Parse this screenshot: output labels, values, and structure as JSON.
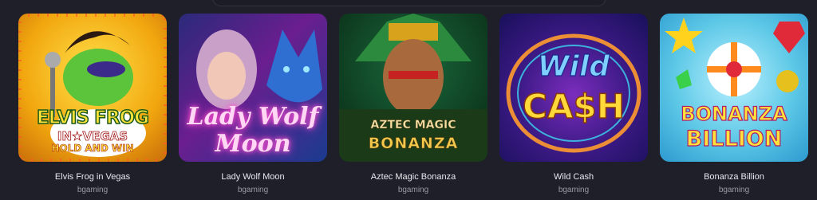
{
  "games": [
    {
      "title": "Elvis Frog in Vegas",
      "provider": "bgaming",
      "logo": [
        "ELVIS FROG",
        "IN★VEGAS",
        "HOLD AND WIN"
      ]
    },
    {
      "title": "Lady Wolf Moon",
      "provider": "bgaming",
      "logo": [
        "Lady Wolf",
        "Moon"
      ]
    },
    {
      "title": "Aztec Magic Bonanza",
      "provider": "bgaming",
      "logo": [
        "AZTEC MAGIC",
        "BONANZA"
      ]
    },
    {
      "title": "Wild Cash",
      "provider": "bgaming",
      "logo": [
        "Wild",
        "CA$H"
      ]
    },
    {
      "title": "Bonanza Billion",
      "provider": "bgaming",
      "logo": [
        "BONANZA",
        "BILLION"
      ]
    }
  ]
}
